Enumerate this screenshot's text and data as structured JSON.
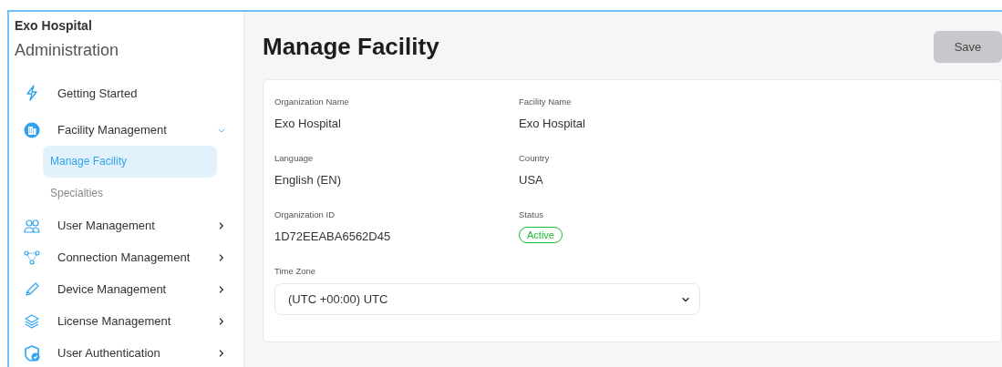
{
  "sidebar": {
    "org": "Exo Hospital",
    "title": "Administration",
    "items": [
      {
        "label": "Getting Started",
        "kind": "link"
      },
      {
        "label": "Facility Management",
        "kind": "group",
        "expanded": true,
        "children": [
          {
            "label": "Manage Facility",
            "selected": true
          },
          {
            "label": "Specialties",
            "selected": false
          }
        ]
      },
      {
        "label": "User Management",
        "kind": "group",
        "expanded": false
      },
      {
        "label": "Connection Management",
        "kind": "group",
        "expanded": false
      },
      {
        "label": "Device Management",
        "kind": "group",
        "expanded": false
      },
      {
        "label": "License Management",
        "kind": "group",
        "expanded": false
      },
      {
        "label": "User Authentication",
        "kind": "group",
        "expanded": false
      }
    ]
  },
  "page": {
    "title": "Manage Facility",
    "save": {
      "label": "Save",
      "disabled": true
    }
  },
  "fields": [
    {
      "label": "Organization Name",
      "value": "Exo Hospital",
      "kind": "text"
    },
    {
      "label": "Facility Name",
      "value": "Exo Hospital",
      "kind": "text"
    },
    {
      "label": "Language",
      "value": "English (EN)",
      "kind": "text"
    },
    {
      "label": "Country",
      "value": "USA",
      "kind": "text"
    },
    {
      "label": "Organization ID",
      "value": "1D72EEABA6562D45",
      "kind": "text"
    },
    {
      "label": "Status",
      "value": "Active",
      "kind": "status"
    }
  ],
  "time_zone": {
    "label": "Time Zone",
    "value": "(UTC +00:00) UTC"
  }
}
